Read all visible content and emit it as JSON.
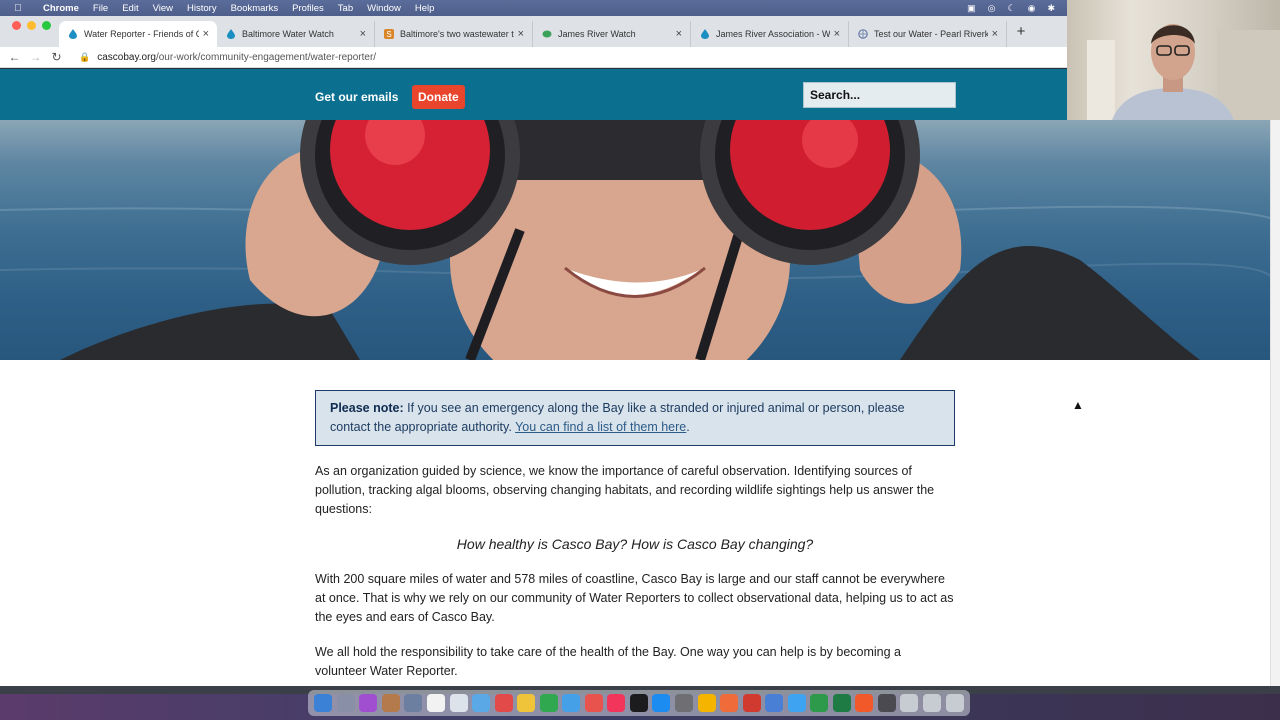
{
  "menubar": {
    "app": "Chrome",
    "items": [
      "File",
      "Edit",
      "View",
      "History",
      "Bookmarks",
      "Profiles",
      "Tab",
      "Window",
      "Help"
    ]
  },
  "tabs": [
    {
      "label": "Water Reporter - Friends of Ca",
      "icon": "water-drop-icon",
      "icon_color": "#1b8ec2"
    },
    {
      "label": "Baltimore Water Watch",
      "icon": "water-drop-icon",
      "icon_color": "#1b8ec2"
    },
    {
      "label": "Baltimore's two wastewater tre",
      "icon": "s-logo-icon",
      "icon_color": "#d9862b"
    },
    {
      "label": "James River Watch",
      "icon": "leaf-icon",
      "icon_color": "#3ba15a"
    },
    {
      "label": "James River Association - Wate",
      "icon": "water-drop-icon",
      "icon_color": "#1b8ec2"
    },
    {
      "label": "Test our Water - Pearl Riverkee",
      "icon": "globe-icon",
      "icon_color": "#6a7fa8"
    }
  ],
  "address": {
    "domain": "cascobay.org",
    "path": "/our-work/community-engagement/water-reporter/"
  },
  "header": {
    "emails_link": "Get our emails",
    "donate_button": "Donate",
    "search_placeholder": "Search..."
  },
  "note": {
    "lead": "Please note:",
    "text": " If you see an emergency along the Bay like a stranded or injured animal or person, please contact the appropriate authority. ",
    "link": "You can find a list of them here",
    "end": "."
  },
  "body": {
    "p1": "As an organization guided by science, we know the importance of careful observation. Identifying sources of pollution, tracking algal blooms, observing changing habitats, and recording wildlife sightings help us answer the questions:",
    "question": "How healthy is Casco Bay? How is Casco Bay changing?",
    "p2": "With 200 square miles of water and 578 miles of coastline, Casco Bay is large and our staff cannot be everywhere at once. That is why we rely on our community of Water Reporters to collect observational data, helping us to act as the eyes and ears of Casco Bay.",
    "p3": "We all hold the responsibility to take care of the health of the Bay. One way you can help is by becoming a volunteer Water Reporter."
  },
  "colors": {
    "header_bg": "#0b7090",
    "donate_bg": "#e8452c",
    "note_bg": "#d9e3ec"
  }
}
